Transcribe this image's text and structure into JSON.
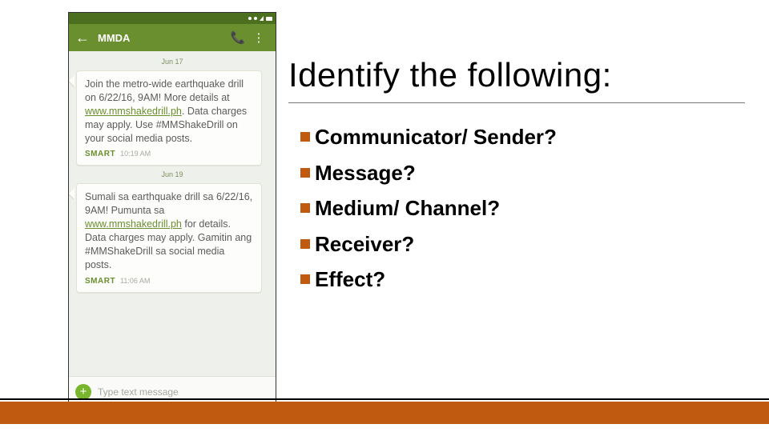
{
  "title": "Identify the following:",
  "bullets": [
    "Communicator/ Sender?",
    "Message?",
    "Medium/ Channel?",
    "Receiver?",
    "Effect?"
  ],
  "phone": {
    "appbar_title": "MMDA",
    "composer_placeholder": "Type text message",
    "dates": {
      "d1": "Jun 17",
      "d2": "Jun 19"
    },
    "msg1": {
      "pre": "Join the metro-wide earthquake drill on 6/22/16, 9AM! More details at ",
      "link": "www.mmshakedrill.ph",
      "post": ". Data charges may apply. Use #MMShakeDrill on your social media posts.",
      "sender": "SMART",
      "time": "10:19 AM"
    },
    "msg2": {
      "pre": "Sumali sa earthquake drill sa 6/22/16, 9AM! Pumunta sa ",
      "link": "www.mmshakedrill.ph",
      "post": " for details. Data charges may apply. Gamitin ang #MMShakeDrill sa social media posts.",
      "sender": "SMART",
      "time": "11:06 AM"
    }
  }
}
